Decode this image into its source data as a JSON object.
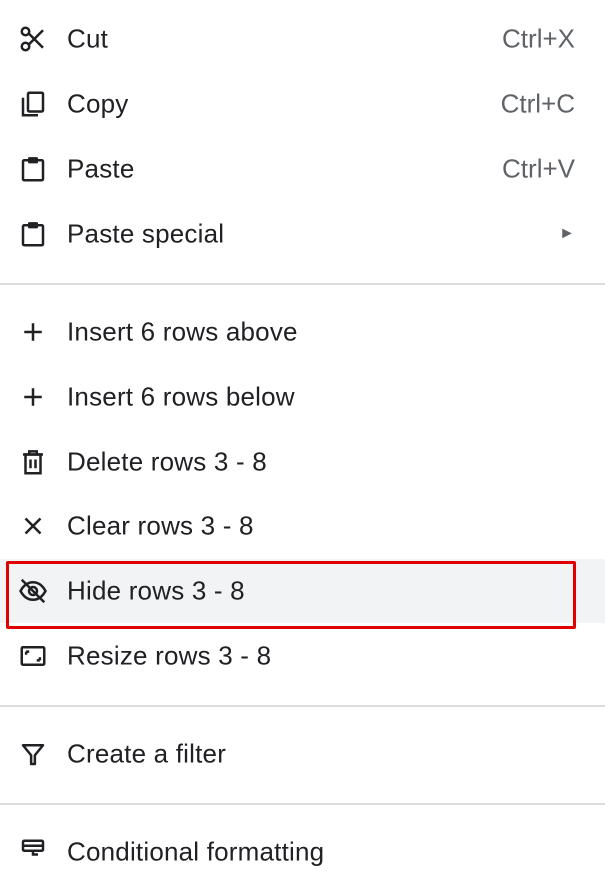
{
  "menu": {
    "clipboard": {
      "cut": {
        "label": "Cut",
        "shortcut": "Ctrl+X",
        "icon": "scissors-icon"
      },
      "copy": {
        "label": "Copy",
        "shortcut": "Ctrl+C",
        "icon": "copy-icon"
      },
      "paste": {
        "label": "Paste",
        "shortcut": "Ctrl+V",
        "icon": "clipboard-icon"
      },
      "paste_special": {
        "label": "Paste special",
        "submenu_indicator": "►",
        "icon": "clipboard-icon"
      }
    },
    "rows": {
      "insert_above": {
        "label": "Insert 6 rows above",
        "icon": "plus-icon"
      },
      "insert_below": {
        "label": "Insert 6 rows below",
        "icon": "plus-icon"
      },
      "delete": {
        "label": "Delete rows 3 - 8",
        "icon": "trash-icon"
      },
      "clear": {
        "label": "Clear rows 3 - 8",
        "icon": "close-icon"
      },
      "hide": {
        "label": "Hide rows 3 - 8",
        "icon": "eye-off-icon",
        "highlighted": true
      },
      "resize": {
        "label": "Resize rows 3 - 8",
        "icon": "resize-icon"
      }
    },
    "filter": {
      "create_filter": {
        "label": "Create a filter",
        "icon": "filter-icon"
      }
    },
    "formatting": {
      "conditional": {
        "label": "Conditional formatting",
        "icon": "paint-roller-icon"
      }
    }
  },
  "colors": {
    "highlight_border": "#e00000",
    "hover_background": "#f1f3f4",
    "text": "#202124",
    "secondary_text": "#5f6368",
    "divider": "#dadce0"
  }
}
